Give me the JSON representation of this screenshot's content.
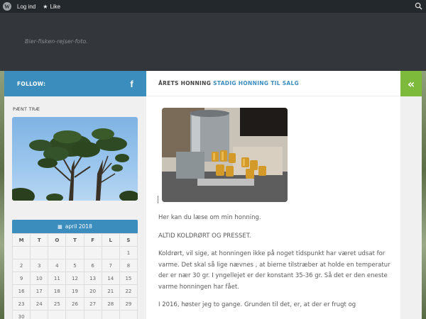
{
  "adminbar": {
    "login": "Log ind",
    "like": "Like"
  },
  "header": {
    "tagline": "Bier-fisken-rejser-foto."
  },
  "sidebar": {
    "follow_label": "FOLLOW:",
    "widget_title": "PÆNT TRÆ",
    "calendar": {
      "month": "april 2018",
      "days": [
        "M",
        "T",
        "O",
        "T",
        "F",
        "L",
        "S"
      ],
      "weeks": [
        [
          "",
          "",
          "",
          "",
          "",
          "",
          "1"
        ],
        [
          "2",
          "3",
          "4",
          "5",
          "6",
          "7",
          "8"
        ],
        [
          "9",
          "10",
          "11",
          "12",
          "13",
          "14",
          "15"
        ],
        [
          "16",
          "17",
          "18",
          "19",
          "20",
          "21",
          "22"
        ],
        [
          "23",
          "24",
          "25",
          "26",
          "27",
          "28",
          "29"
        ],
        [
          "30",
          "",
          "",
          "",
          "",
          "",
          ""
        ]
      ]
    }
  },
  "main": {
    "title_part1": "ÅRETS HONNING",
    "title_part2": "STADIG HONNING TIL SALG",
    "paragraphs": [
      "Her kan du læse om min honning.",
      "ALTID KOLDRØRT OG PRESSET.",
      "Koldrørt, vil sige, at honningen ikke på noget tidspunkt har været udsat for varme. Det skal så lige nævnes , at bierne tilstræber at holde en temperatur der er nær 30 gr. I yngellejet er der konstant 35-36 gr. Så det er den eneste varme honningen har fået.",
      "I 2016, høster jeg to gange. Grunden til det, er, at der er frugt og"
    ]
  },
  "colors": {
    "accent_blue": "#3b8dbd",
    "accent_green": "#7dba3b",
    "header_dark": "#33363b",
    "adminbar": "#23282d"
  },
  "icons": {
    "wordpress": "wordpress-logo-icon",
    "like": "star-icon",
    "search": "search-icon",
    "facebook": "facebook-icon",
    "calendar": "calendar-icon",
    "toggle": "double-chevron-left-icon"
  }
}
